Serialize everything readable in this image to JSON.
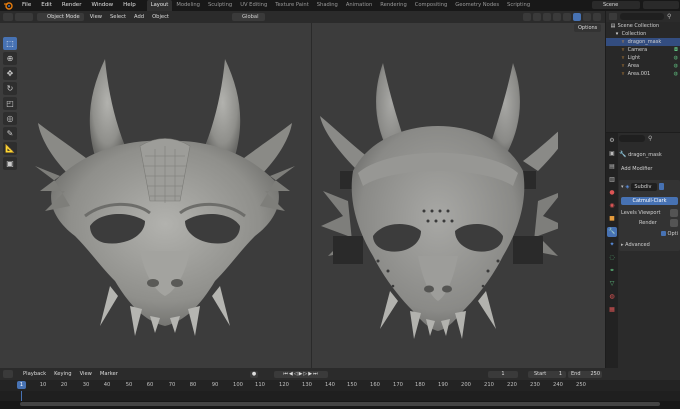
{
  "menubar": {
    "items": [
      "File",
      "Edit",
      "Render",
      "Window",
      "Help"
    ],
    "workspaces": [
      "Layout",
      "Modeling",
      "Sculpting",
      "UV Editing",
      "Texture Paint",
      "Shading",
      "Animation",
      "Rendering",
      "Compositing",
      "Geometry Nodes",
      "Scripting"
    ],
    "active_workspace": "Layout",
    "scene_label": "Scene"
  },
  "viewport_header": {
    "mode": "Object Mode",
    "menus": [
      "View",
      "Select",
      "Add",
      "Object"
    ],
    "orientation": "Global",
    "options": "Options"
  },
  "outliner": {
    "title": "Scene Collection",
    "rows": [
      {
        "label": "Collection",
        "icon": "collection-icon"
      },
      {
        "label": "dragon_mask",
        "icon": "mesh-icon",
        "selected": true
      },
      {
        "label": "Camera",
        "icon": "camera-icon"
      },
      {
        "label": "Light",
        "icon": "light-icon"
      },
      {
        "label": "Area",
        "icon": "light-icon"
      },
      {
        "label": "Area.001",
        "icon": "light-icon"
      }
    ]
  },
  "properties": {
    "object_name": "dragon_mask",
    "add_modifier": "Add Modifier",
    "modifier_name": "Subdiv",
    "algorithm": "Catmull-Clark",
    "levels_viewport_label": "Levels Viewport",
    "render_label": "Render",
    "optimal_label": "Opti",
    "advanced_label": "Advanced"
  },
  "timeline": {
    "menus": [
      "Playback",
      "Keying",
      "View",
      "Marker"
    ],
    "current_frame": "1",
    "start_label": "Start",
    "start_value": "1",
    "end_label": "End",
    "end_value": "250",
    "ticks": [
      "1",
      "10",
      "20",
      "30",
      "40",
      "50",
      "60",
      "70",
      "80",
      "90",
      "100",
      "110",
      "120",
      "130",
      "140",
      "150",
      "160",
      "170",
      "180",
      "190",
      "200",
      "210",
      "220",
      "230",
      "240",
      "250"
    ]
  },
  "colors": {
    "accent": "#4772b3",
    "viewport_bg": "#3c3c3c",
    "mask_clay": "#9a9a96",
    "strap_dark": "#2a2a2a"
  }
}
